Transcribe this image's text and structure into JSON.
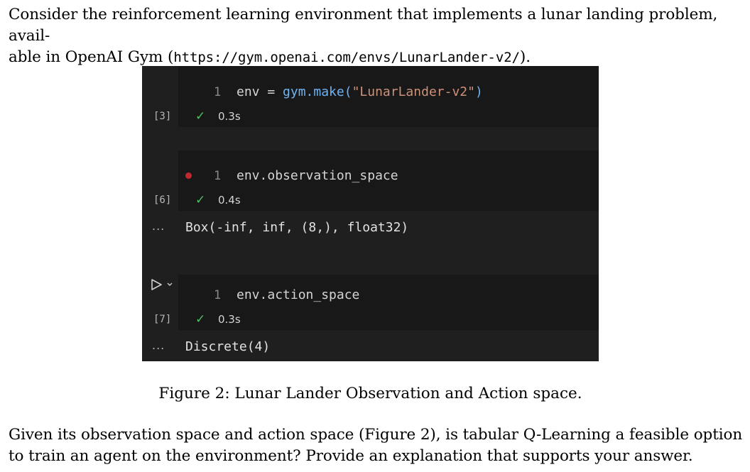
{
  "intro": {
    "line1": "Consider the reinforcement learning environment that implements a lunar landing problem, avail-",
    "line2_prefix": "able in OpenAI Gym (",
    "url": "https://gym.openai.com/envs/LunarLander-v2/",
    "line2_suffix": ")."
  },
  "notebook": {
    "cells": [
      {
        "line_number": "1",
        "code_var": "env",
        "code_op": " = ",
        "code_fn": "gym.make(",
        "code_str": "\"LunarLander-v2\"",
        "code_close": ")",
        "exec_count": "[3]",
        "status": "✓",
        "duration": "0.3s"
      },
      {
        "line_number": "1",
        "code_var": "env",
        "code_attr": ".observation_space",
        "exec_count": "[6]",
        "status": "✓",
        "duration": "0.4s",
        "output_marker": "...",
        "output": "Box(-inf, inf, (8,), float32)"
      },
      {
        "line_number": "1",
        "code_var": "env",
        "code_attr": ".action_space",
        "exec_count": "[7]",
        "status": "✓",
        "duration": "0.3s",
        "output_marker": "...",
        "output": "Discrete(4)"
      }
    ],
    "colors": {
      "background": "#1f1f1f",
      "cell_background": "#181818",
      "success": "#4ec25e",
      "breakpoint": "#c0282f",
      "function": "#6fb3f2",
      "string": "#ce9178"
    }
  },
  "caption": "Figure 2: Lunar Lander Observation and Action space.",
  "question": {
    "line1": "Given its observation space and action space (Figure 2), is tabular Q-Learning a feasible option",
    "line2": "to train an agent on the environment? Provide an explanation that supports your answer."
  }
}
